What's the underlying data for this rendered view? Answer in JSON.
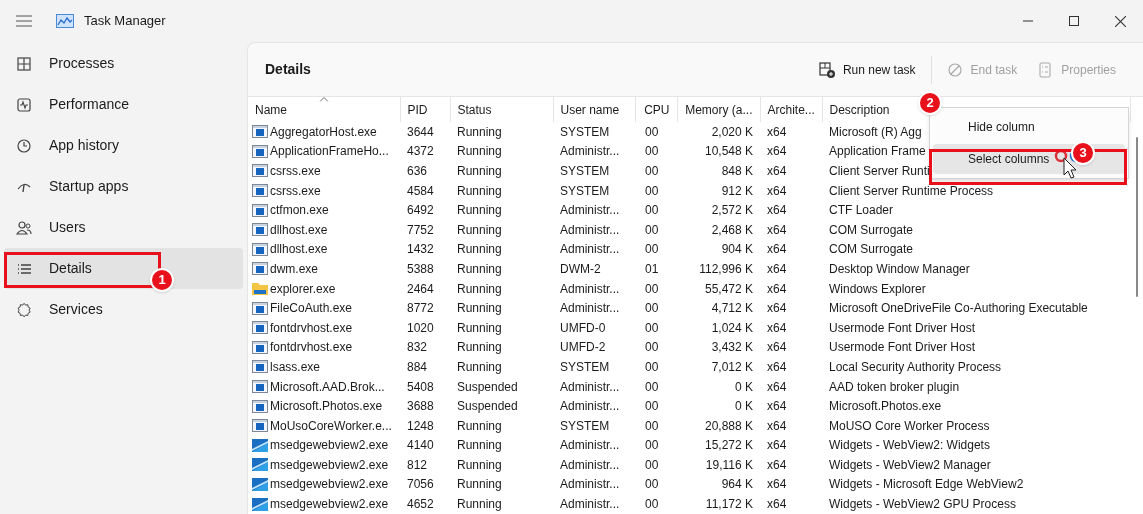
{
  "window": {
    "title": "Task Manager"
  },
  "sidebar": {
    "items": [
      {
        "label": "Processes",
        "selected": false
      },
      {
        "label": "Performance",
        "selected": false
      },
      {
        "label": "App history",
        "selected": false
      },
      {
        "label": "Startup apps",
        "selected": false
      },
      {
        "label": "Users",
        "selected": false
      },
      {
        "label": "Details",
        "selected": true
      },
      {
        "label": "Services",
        "selected": false
      }
    ]
  },
  "page_title": "Details",
  "toolbar": [
    {
      "label": "Run new task",
      "disabled": false
    },
    {
      "label": "End task",
      "disabled": true
    },
    {
      "label": "Properties",
      "disabled": true
    }
  ],
  "table": {
    "columns": [
      {
        "label": "Name",
        "sorted": true
      },
      {
        "label": "PID",
        "sorted": false
      },
      {
        "label": "Status",
        "sorted": false
      },
      {
        "label": "User name",
        "sorted": false
      },
      {
        "label": "CPU",
        "sorted": false
      },
      {
        "label": "Memory (a...",
        "sorted": false
      },
      {
        "label": "Archite...",
        "sorted": false
      },
      {
        "label": "Description",
        "sorted": false
      }
    ],
    "rows": [
      {
        "kind": "app",
        "cells": [
          "AggregatorHost.exe",
          "3644",
          "Running",
          "SYSTEM",
          "00",
          "2,020 K",
          "x64",
          "Microsoft (R) Agg"
        ]
      },
      {
        "kind": "app",
        "cells": [
          "ApplicationFrameHo...",
          "4372",
          "Running",
          "Administr...",
          "00",
          "10,548 K",
          "x64",
          "Application Frame"
        ]
      },
      {
        "kind": "app",
        "cells": [
          "csrss.exe",
          "636",
          "Running",
          "SYSTEM",
          "00",
          "848 K",
          "x64",
          "Client Server Runti"
        ]
      },
      {
        "kind": "app",
        "cells": [
          "csrss.exe",
          "4584",
          "Running",
          "SYSTEM",
          "00",
          "912 K",
          "x64",
          "Client Server Runtime Process"
        ]
      },
      {
        "kind": "app",
        "cells": [
          "ctfmon.exe",
          "6492",
          "Running",
          "Administr...",
          "00",
          "2,572 K",
          "x64",
          "CTF Loader"
        ]
      },
      {
        "kind": "app",
        "cells": [
          "dllhost.exe",
          "7752",
          "Running",
          "Administr...",
          "00",
          "2,468 K",
          "x64",
          "COM Surrogate"
        ]
      },
      {
        "kind": "app",
        "cells": [
          "dllhost.exe",
          "1432",
          "Running",
          "Administr...",
          "00",
          "904 K",
          "x64",
          "COM Surrogate"
        ]
      },
      {
        "kind": "app",
        "cells": [
          "dwm.exe",
          "5388",
          "Running",
          "DWM-2",
          "01",
          "112,996 K",
          "x64",
          "Desktop Window Manager"
        ]
      },
      {
        "kind": "folder",
        "cells": [
          "explorer.exe",
          "2464",
          "Running",
          "Administr...",
          "00",
          "55,472 K",
          "x64",
          "Windows Explorer"
        ]
      },
      {
        "kind": "app",
        "cells": [
          "FileCoAuth.exe",
          "8772",
          "Running",
          "Administr...",
          "00",
          "4,712 K",
          "x64",
          "Microsoft OneDriveFile Co-Authoring Executable"
        ]
      },
      {
        "kind": "app",
        "cells": [
          "fontdrvhost.exe",
          "1020",
          "Running",
          "UMFD-0",
          "00",
          "1,024 K",
          "x64",
          "Usermode Font Driver Host"
        ]
      },
      {
        "kind": "app",
        "cells": [
          "fontdrvhost.exe",
          "832",
          "Running",
          "UMFD-2",
          "00",
          "3,432 K",
          "x64",
          "Usermode Font Driver Host"
        ]
      },
      {
        "kind": "app",
        "cells": [
          "lsass.exe",
          "884",
          "Running",
          "SYSTEM",
          "00",
          "7,012 K",
          "x64",
          "Local Security Authority Process"
        ]
      },
      {
        "kind": "app",
        "cells": [
          "Microsoft.AAD.Brok...",
          "5408",
          "Suspended",
          "Administr...",
          "00",
          "0 K",
          "x64",
          "AAD token broker plugin"
        ]
      },
      {
        "kind": "app",
        "cells": [
          "Microsoft.Photos.exe",
          "3688",
          "Suspended",
          "Administr...",
          "00",
          "0 K",
          "x64",
          "Microsoft.Photos.exe"
        ]
      },
      {
        "kind": "app",
        "cells": [
          "MoUsoCoreWorker.e...",
          "1248",
          "Running",
          "SYSTEM",
          "00",
          "20,888 K",
          "x64",
          "MoUSO Core Worker Process"
        ]
      },
      {
        "kind": "webview",
        "cells": [
          "msedgewebview2.exe",
          "4140",
          "Running",
          "Administr...",
          "00",
          "15,272 K",
          "x64",
          "Widgets - WebView2: Widgets"
        ]
      },
      {
        "kind": "webview",
        "cells": [
          "msedgewebview2.exe",
          "812",
          "Running",
          "Administr...",
          "00",
          "19,116 K",
          "x64",
          "Widgets - WebView2 Manager"
        ]
      },
      {
        "kind": "webview",
        "cells": [
          "msedgewebview2.exe",
          "7056",
          "Running",
          "Administr...",
          "00",
          "964 K",
          "x64",
          "Widgets - Microsoft Edge WebView2"
        ]
      },
      {
        "kind": "webview",
        "cells": [
          "msedgewebview2.exe",
          "4652",
          "Running",
          "Administr...",
          "00",
          "11,172 K",
          "x64",
          "Widgets - WebView2 GPU Process"
        ]
      }
    ]
  },
  "context_menu": {
    "items": [
      {
        "label": "Hide column",
        "selected": false
      },
      {
        "label": "Select columns",
        "selected": true
      }
    ]
  },
  "callouts": [
    {
      "number": "1"
    },
    {
      "number": "2"
    },
    {
      "number": "3"
    }
  ]
}
